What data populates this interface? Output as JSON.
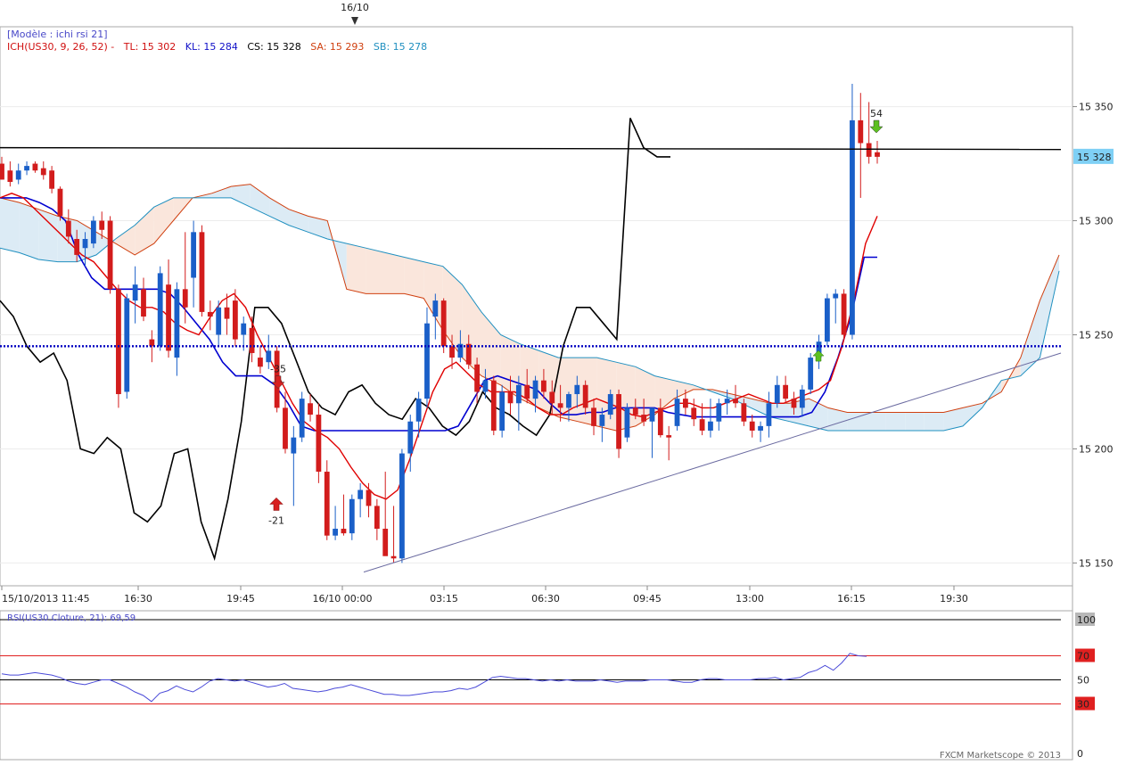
{
  "header": {
    "date_marker": "16/10",
    "model_label": "[Modèle : ichi rsi 21]",
    "ich_label": "ICH(US30, 9, 26, 52) -",
    "tl": "TL: 15 302",
    "kl": "KL: 15 284",
    "cs": "CS: 15 328",
    "sa": "SA: 15 293",
    "sb": "SB: 15 278"
  },
  "colors": {
    "tenkan": "#e00000",
    "kijun": "#0000d0",
    "chikou": "#000000",
    "senkou_a": "#d04010",
    "senkou_b": "#2090c0",
    "cloud_bull": "#dcebf5",
    "cloud_bear": "#fae6dc",
    "up_candle": "#1a5fc8",
    "down_candle": "#d21c1c",
    "rsi": "#4a4ad8",
    "price_tag": "#7fd0f5"
  },
  "chart_data": [
    {
      "type": "candlestick",
      "title": "ICH(US30, 9, 26, 52)",
      "ylim": [
        15140,
        15385
      ],
      "y_ticks": [
        "15 150",
        "15 200",
        "15 250",
        "15 300",
        "15 350"
      ],
      "x_ticks": [
        "15/10/2013 11:45",
        "16:30",
        "19:45",
        "16/10 00:00",
        "03:15",
        "06:30",
        "09:45",
        "13:00",
        "16:15",
        "19:30"
      ],
      "last_price": "15 328",
      "horizontal_levels": [
        15332,
        15245
      ],
      "trend_line": [
        [
          15146,
          15242
        ]
      ],
      "signals": [
        {
          "label": "-21",
          "direction": "up",
          "price": 15175
        },
        {
          "label": "-35",
          "direction": "down",
          "price": 15230
        },
        {
          "label": "54",
          "direction": "down",
          "price": 15342
        }
      ],
      "candles": [
        [
          15325,
          15328,
          15318,
          15318
        ],
        [
          15322,
          15326,
          15315,
          15317
        ],
        [
          15318,
          15325,
          15316,
          15322
        ],
        [
          15322,
          15326,
          15320,
          15324
        ],
        [
          15325,
          15326,
          15321,
          15322
        ],
        [
          15323,
          15326,
          15318,
          15320
        ],
        [
          15322,
          15324,
          15312,
          15314
        ],
        [
          15314,
          15315,
          15300,
          15302
        ],
        [
          15300,
          15305,
          15290,
          15293
        ],
        [
          15292,
          15296,
          15282,
          15285
        ],
        [
          15288,
          15295,
          15280,
          15292
        ],
        [
          15290,
          15302,
          15288,
          15300
        ],
        [
          15300,
          15304,
          15292,
          15296
        ],
        [
          15300,
          15302,
          15268,
          15270
        ],
        [
          15270,
          15272,
          15218,
          15224
        ],
        [
          15225,
          15268,
          15222,
          15266
        ],
        [
          15265,
          15280,
          15255,
          15272
        ],
        [
          15270,
          15275,
          15256,
          15258
        ],
        [
          15248,
          15252,
          15238,
          15245
        ],
        [
          15245,
          15280,
          15243,
          15277
        ],
        [
          15272,
          15283,
          15240,
          15243
        ],
        [
          15240,
          15273,
          15232,
          15270
        ],
        [
          15270,
          15295,
          15255,
          15262
        ],
        [
          15275,
          15300,
          15262,
          15295
        ],
        [
          15295,
          15298,
          15258,
          15260
        ],
        [
          15260,
          15265,
          15252,
          15258
        ],
        [
          15250,
          15265,
          15245,
          15262
        ],
        [
          15262,
          15268,
          15250,
          15257
        ],
        [
          15265,
          15270,
          15245,
          15248
        ],
        [
          15250,
          15258,
          15243,
          15255
        ],
        [
          15253,
          15258,
          15238,
          15242
        ],
        [
          15240,
          15245,
          15233,
          15236
        ],
        [
          15238,
          15250,
          15235,
          15243
        ],
        [
          15243,
          15245,
          15216,
          15218
        ],
        [
          15218,
          15225,
          15198,
          15200
        ],
        [
          15198,
          15210,
          15175,
          15205
        ],
        [
          15205,
          15225,
          15203,
          15222
        ],
        [
          15220,
          15224,
          15212,
          15215
        ],
        [
          15215,
          15220,
          15185,
          15190
        ],
        [
          15190,
          15195,
          15160,
          15162
        ],
        [
          15162,
          15175,
          15160,
          15165
        ],
        [
          15165,
          15180,
          15162,
          15163
        ],
        [
          15163,
          15180,
          15160,
          15178
        ],
        [
          15178,
          15185,
          15170,
          15182
        ],
        [
          15182,
          15185,
          15170,
          15175
        ],
        [
          15175,
          15178,
          15160,
          15165
        ],
        [
          15165,
          15190,
          15155,
          15153
        ],
        [
          15153,
          15175,
          15150,
          15152
        ],
        [
          15152,
          15200,
          15150,
          15198
        ],
        [
          15198,
          15215,
          15190,
          15212
        ],
        [
          15212,
          15225,
          15205,
          15222
        ],
        [
          15222,
          15262,
          15218,
          15255
        ],
        [
          15258,
          15268,
          15248,
          15265
        ],
        [
          15265,
          15266,
          15242,
          15245
        ],
        [
          15245,
          15250,
          15235,
          15240
        ],
        [
          15240,
          15252,
          15238,
          15246
        ],
        [
          15246,
          15250,
          15235,
          15237
        ],
        [
          15237,
          15240,
          15220,
          15225
        ],
        [
          15225,
          15235,
          15222,
          15230
        ],
        [
          15230,
          15232,
          15206,
          15208
        ],
        [
          15208,
          15228,
          15205,
          15225
        ],
        [
          15225,
          15232,
          15215,
          15220
        ],
        [
          15220,
          15232,
          15208,
          15228
        ],
        [
          15228,
          15235,
          15220,
          15222
        ],
        [
          15222,
          15232,
          15216,
          15230
        ],
        [
          15230,
          15235,
          15222,
          15225
        ],
        [
          15225,
          15230,
          15215,
          15220
        ],
        [
          15220,
          15228,
          15212,
          15218
        ],
        [
          15218,
          15225,
          15212,
          15224
        ],
        [
          15224,
          15232,
          15218,
          15228
        ],
        [
          15228,
          15230,
          15215,
          15218
        ],
        [
          15218,
          15222,
          15206,
          15210
        ],
        [
          15210,
          15218,
          15203,
          15215
        ],
        [
          15215,
          15226,
          15213,
          15224
        ],
        [
          15224,
          15226,
          15196,
          15200
        ],
        [
          15205,
          15220,
          15203,
          15218
        ],
        [
          15218,
          15222,
          15213,
          15215
        ],
        [
          15215,
          15222,
          15210,
          15212
        ],
        [
          15212,
          15218,
          15196,
          15218
        ],
        [
          15218,
          15222,
          15205,
          15206
        ],
        [
          15206,
          15210,
          15195,
          15205
        ],
        [
          15210,
          15226,
          15208,
          15222
        ],
        [
          15222,
          15226,
          15215,
          15218
        ],
        [
          15218,
          15222,
          15210,
          15213
        ],
        [
          15213,
          15220,
          15206,
          15208
        ],
        [
          15208,
          15222,
          15205,
          15212
        ],
        [
          15212,
          15222,
          15208,
          15220
        ],
        [
          15220,
          15226,
          15215,
          15222
        ],
        [
          15222,
          15228,
          15218,
          15220
        ],
        [
          15220,
          15222,
          15210,
          15212
        ],
        [
          15212,
          15215,
          15205,
          15208
        ],
        [
          15208,
          15212,
          15203,
          15210
        ],
        [
          15210,
          15225,
          15205,
          15220
        ],
        [
          15220,
          15232,
          15218,
          15228
        ],
        [
          15228,
          15232,
          15220,
          15222
        ],
        [
          15222,
          15225,
          15215,
          15218
        ],
        [
          15218,
          15228,
          15214,
          15226
        ],
        [
          15226,
          15242,
          15224,
          15240
        ],
        [
          15240,
          15250,
          15235,
          15247
        ],
        [
          15247,
          15268,
          15245,
          15266
        ],
        [
          15266,
          15270,
          15255,
          15268
        ],
        [
          15268,
          15270,
          15248,
          15250
        ],
        [
          15250,
          15360,
          15248,
          15344
        ],
        [
          15344,
          15356,
          15310,
          15334
        ],
        [
          15334,
          15352,
          15325,
          15328
        ],
        [
          15330,
          15335,
          15325,
          15328
        ]
      ],
      "tenkan_sen": [
        15310,
        15312,
        15310,
        15305,
        15300,
        15295,
        15290,
        15285,
        15282,
        15276,
        15270,
        15265,
        15262,
        15262,
        15260,
        15255,
        15252,
        15250,
        15258,
        15265,
        15268,
        15262,
        15250,
        15240,
        15230,
        15220,
        15212,
        15208,
        15205,
        15200,
        15192,
        15185,
        15180,
        15178,
        15182,
        15195,
        15210,
        15225,
        15235,
        15238,
        15233,
        15228,
        15225,
        15225,
        15225,
        15222,
        15218,
        15215,
        15215,
        15218,
        15220,
        15222,
        15220,
        15218,
        15215,
        15214,
        15216,
        15218,
        15220,
        15220,
        15218,
        15218,
        15220,
        15222,
        15224,
        15222,
        15220,
        15220,
        15222,
        15224,
        15226,
        15230,
        15245,
        15265,
        15290,
        15302
      ],
      "kijun_sen": [
        15310,
        15310,
        15310,
        15308,
        15305,
        15300,
        15285,
        15275,
        15270,
        15270,
        15270,
        15270,
        15270,
        15268,
        15262,
        15255,
        15248,
        15238,
        15232,
        15232,
        15232,
        15228,
        15220,
        15210,
        15208,
        15208,
        15208,
        15208,
        15208,
        15208,
        15208,
        15208,
        15208,
        15208,
        15208,
        15210,
        15220,
        15230,
        15232,
        15230,
        15228,
        15226,
        15220,
        15215,
        15215,
        15216,
        15216,
        15218,
        15218,
        15218,
        15218,
        15216,
        15215,
        15214,
        15214,
        15214,
        15214,
        15214,
        15214,
        15214,
        15214,
        15214,
        15216,
        15225,
        15240,
        15258,
        15284,
        15284
      ],
      "chikou_span": [
        15265,
        15258,
        15245,
        15238,
        15242,
        15230,
        15200,
        15198,
        15205,
        15200,
        15172,
        15168,
        15175,
        15198,
        15200,
        15168,
        15152,
        15178,
        15212,
        15262,
        15262,
        15255,
        15240,
        15225,
        15218,
        15215,
        15225,
        15228,
        15220,
        15215,
        15213,
        15222,
        15218,
        15210,
        15206,
        15212,
        15225,
        15218,
        15215,
        15210,
        15206,
        15215,
        15245,
        15262,
        15262,
        15255,
        15248,
        15345,
        15332,
        15328,
        15328
      ],
      "senkou_span_a": [
        15310,
        15308,
        15305,
        15302,
        15300,
        15295,
        15290,
        15285,
        15290,
        15300,
        15310,
        15312,
        15315,
        15316,
        15310,
        15305,
        15302,
        15300,
        15270,
        15268,
        15268,
        15268,
        15266,
        15252,
        15240,
        15232,
        15228,
        15222,
        15218,
        15214,
        15212,
        15210,
        15208,
        15210,
        15215,
        15222,
        15226,
        15226,
        15224,
        15222,
        15220,
        15220,
        15222,
        15218,
        15216,
        15216,
        15216,
        15216,
        15216,
        15216,
        15218,
        15220,
        15225,
        15240,
        15265,
        15285
      ],
      "senkou_span_b": [
        15288,
        15286,
        15283,
        15282,
        15282,
        15285,
        15292,
        15298,
        15306,
        15310,
        15310,
        15310,
        15310,
        15306,
        15302,
        15298,
        15295,
        15292,
        15290,
        15288,
        15286,
        15284,
        15282,
        15280,
        15272,
        15260,
        15250,
        15246,
        15243,
        15240,
        15240,
        15240,
        15238,
        15236,
        15232,
        15230,
        15228,
        15225,
        15222,
        15218,
        15214,
        15212,
        15210,
        15208,
        15208,
        15208,
        15208,
        15208,
        15208,
        15208,
        15210,
        15218,
        15230,
        15232,
        15240,
        15278
      ]
    },
    {
      "type": "line",
      "title": "RSI(US30.Cloture, 21): 69,59",
      "ylim": [
        0,
        100
      ],
      "levels": [
        30,
        50,
        70,
        100
      ],
      "y_ticks": [
        "100",
        "70",
        "50",
        "30",
        "0"
      ],
      "last_value": 69.59,
      "values": [
        55,
        54,
        54,
        55,
        56,
        55,
        54,
        52,
        49,
        47,
        46,
        48,
        50,
        50,
        47,
        44,
        40,
        37,
        32,
        39,
        41,
        45,
        42,
        40,
        44,
        49,
        51,
        50,
        49,
        50,
        48,
        46,
        44,
        45,
        47,
        43,
        42,
        41,
        40,
        41,
        43,
        44,
        46,
        44,
        42,
        40,
        38,
        38,
        37,
        37,
        38,
        39,
        40,
        40,
        41,
        43,
        42,
        44,
        48,
        52,
        53,
        52,
        51,
        51,
        50,
        49,
        50,
        49,
        50,
        49,
        49,
        49,
        50,
        49,
        48,
        49,
        49,
        49,
        50,
        50,
        50,
        49,
        48,
        48,
        50,
        51,
        51,
        50,
        50,
        50,
        50,
        51,
        51,
        52,
        50,
        51,
        52,
        56,
        58,
        62,
        58,
        64,
        72,
        70,
        69.59
      ]
    }
  ],
  "footer": {
    "copyright": "FXCM Marketscope © 2013"
  }
}
